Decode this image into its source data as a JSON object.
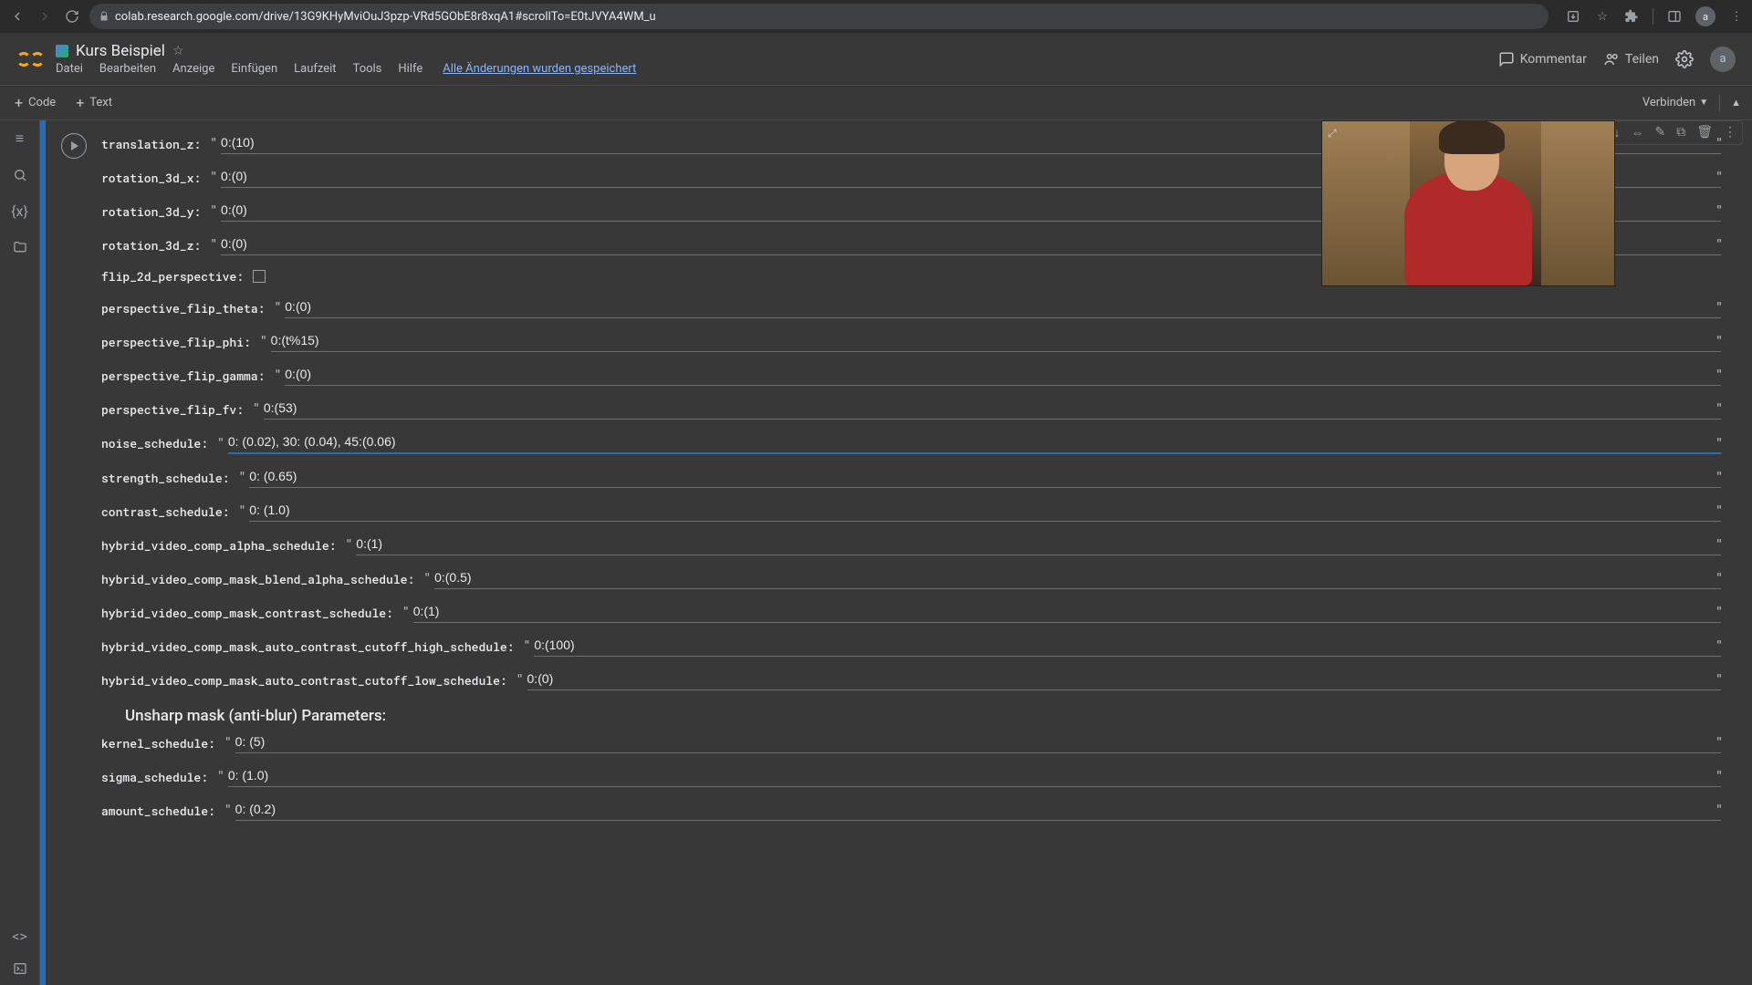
{
  "browser": {
    "url": "colab.research.google.com/drive/13G9KHyMviOuJ3pzp-VRd5GObE8r8xqA1#scrollTo=E0tJVYA4WM_u",
    "avatar": "a"
  },
  "header": {
    "title": "Kurs Beispiel",
    "menus": [
      "Datei",
      "Bearbeiten",
      "Anzeige",
      "Einfügen",
      "Laufzeit",
      "Tools",
      "Hilfe"
    ],
    "saved_text": "Alle Änderungen wurden gespeichert",
    "comment": "Kommentar",
    "share": "Teilen",
    "avatar": "a"
  },
  "toolbar": {
    "code": "Code",
    "text": "Text",
    "connect": "Verbinden"
  },
  "section_unsharp": "Unsharp mask (anti-blur) Parameters:",
  "fields": {
    "translation_z": {
      "label": "translation_z:",
      "value": "0:(10)"
    },
    "rotation_3d_x": {
      "label": "rotation_3d_x:",
      "value": "0:(0)"
    },
    "rotation_3d_y": {
      "label": "rotation_3d_y:",
      "value": "0:(0)"
    },
    "rotation_3d_z": {
      "label": "rotation_3d_z:",
      "value": "0:(0)"
    },
    "flip_2d_perspective": {
      "label": "flip_2d_perspective:"
    },
    "perspective_flip_theta": {
      "label": "perspective_flip_theta:",
      "value": "0:(0)"
    },
    "perspective_flip_phi": {
      "label": "perspective_flip_phi:",
      "value": "0:(t%15)"
    },
    "perspective_flip_gamma": {
      "label": "perspective_flip_gamma:",
      "value": "0:(0)"
    },
    "perspective_flip_fv": {
      "label": "perspective_flip_fv:",
      "value": "0:(53)"
    },
    "noise_schedule": {
      "label": "noise_schedule:",
      "value": "0: (0.02), 30: (0.04), 45:(0.06)"
    },
    "strength_schedule": {
      "label": "strength_schedule:",
      "value": "0: (0.65)"
    },
    "contrast_schedule": {
      "label": "contrast_schedule:",
      "value": "0: (1.0)"
    },
    "hybrid_video_comp_alpha_schedule": {
      "label": "hybrid_video_comp_alpha_schedule:",
      "value": "0:(1)"
    },
    "hybrid_video_comp_mask_blend_alpha_schedule": {
      "label": "hybrid_video_comp_mask_blend_alpha_schedule:",
      "value": "0:(0.5)"
    },
    "hybrid_video_comp_mask_contrast_schedule": {
      "label": "hybrid_video_comp_mask_contrast_schedule:",
      "value": "0:(1)"
    },
    "hybrid_video_comp_mask_auto_contrast_cutoff_high_schedule": {
      "label": "hybrid_video_comp_mask_auto_contrast_cutoff_high_schedule:",
      "value": "0:(100)"
    },
    "hybrid_video_comp_mask_auto_contrast_cutoff_low_schedule": {
      "label": "hybrid_video_comp_mask_auto_contrast_cutoff_low_schedule:",
      "value": "0:(0)"
    },
    "kernel_schedule": {
      "label": "kernel_schedule:",
      "value": "0: (5)"
    },
    "sigma_schedule": {
      "label": "sigma_schedule:",
      "value": "0: (1.0)"
    },
    "amount_schedule": {
      "label": "amount_schedule:",
      "value": "0: (0.2)"
    }
  }
}
